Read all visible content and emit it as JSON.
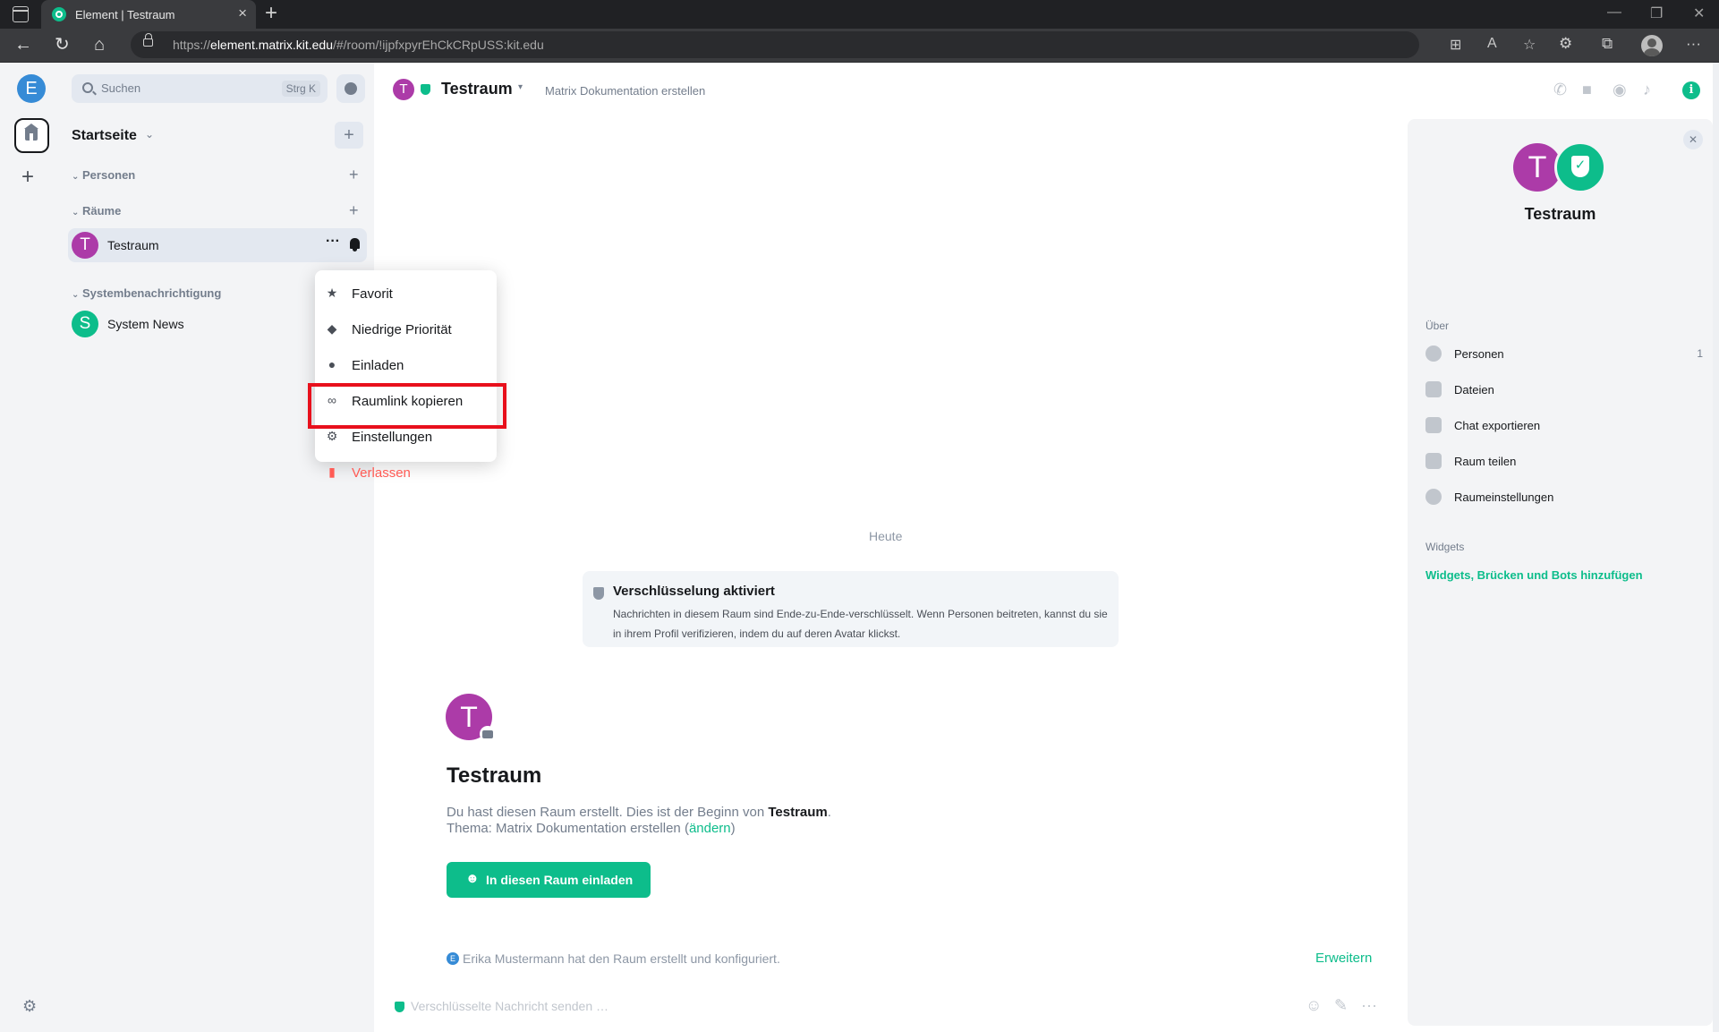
{
  "browser": {
    "tab_title": "Element | Testraum",
    "url_host": "element.matrix.kit.edu",
    "url_prefix": "https://",
    "url_path": "/#/room/!ijpfxpyrEhCkCRpUSS:kit.edu",
    "new_tab": "+",
    "tab_close": "×"
  },
  "spaces": {
    "user_initial": "E",
    "add_space": "+"
  },
  "roomlist": {
    "search_placeholder": "Suchen",
    "search_shortcut": "Strg K",
    "home_title": "Startseite",
    "home_add": "+",
    "sections": {
      "people": "Personen",
      "rooms": "Räume",
      "system": "Systembenachrichtigung"
    },
    "rooms": [
      {
        "initial": "T",
        "name": "Testraum",
        "color": "#ac3ba8"
      }
    ],
    "system_rooms": [
      {
        "initial": "S",
        "name": "System News",
        "color": "#0dbd8b"
      }
    ],
    "room_options": "···"
  },
  "context_menu": {
    "items": [
      {
        "label": "Favorit",
        "icon": "star-icon"
      },
      {
        "label": "Niedrige Priorität",
        "icon": "low-priority-icon"
      },
      {
        "label": "Einladen",
        "icon": "invite-icon"
      },
      {
        "label": "Raumlink kopieren",
        "icon": "link-icon"
      },
      {
        "label": "Einstellungen",
        "icon": "gear-icon"
      },
      {
        "label": "Verlassen",
        "icon": "leave-icon"
      }
    ],
    "highlight_color": "#e8101c"
  },
  "header": {
    "initial": "T",
    "title": "Testraum",
    "topic": "Matrix Dokumentation erstellen",
    "info": "i"
  },
  "timeline": {
    "date_separator": "Heute",
    "encryption": {
      "title": "Verschlüsselung aktiviert",
      "body": "Nachrichten in diesem Raum sind Ende-zu-Ende-verschlüsselt. Wenn Personen beitreten, kannst du sie in ihrem Profil verifizieren, indem du auf deren Avatar klickst."
    },
    "intro": {
      "initial": "T",
      "title": "Testraum",
      "created_prefix": "Du hast diesen Raum erstellt. Dies ist der Beginn von ",
      "created_room": "Testraum",
      "created_suffix": ".",
      "topic_prefix": "Thema: Matrix Dokumentation erstellen (",
      "topic_link": "ändern",
      "topic_suffix": ")",
      "invite_button": "In diesen Raum einladen"
    },
    "created_event": {
      "initial": "E",
      "text": "Erika Mustermann hat den Raum erstellt und konfiguriert.",
      "expand": "Erweitern"
    }
  },
  "composer": {
    "placeholder": "Verschlüsselte Nachricht senden …",
    "more": "···"
  },
  "right_panel": {
    "close": "✕",
    "initial": "T",
    "room_name": "Testraum",
    "about_heading": "Über",
    "items": [
      {
        "label": "Personen",
        "count": "1"
      },
      {
        "label": "Dateien",
        "count": ""
      },
      {
        "label": "Chat exportieren",
        "count": ""
      },
      {
        "label": "Raum teilen",
        "count": ""
      },
      {
        "label": "Raumeinstellungen",
        "count": ""
      }
    ],
    "widgets_heading": "Widgets",
    "widgets_link": "Widgets, Brücken und Bots hinzufügen"
  },
  "colors": {
    "accent": "#0dbd8b",
    "danger": "#ff5b55",
    "room_avatar": "#ac3ba8",
    "user_avatar": "#368bd6"
  }
}
